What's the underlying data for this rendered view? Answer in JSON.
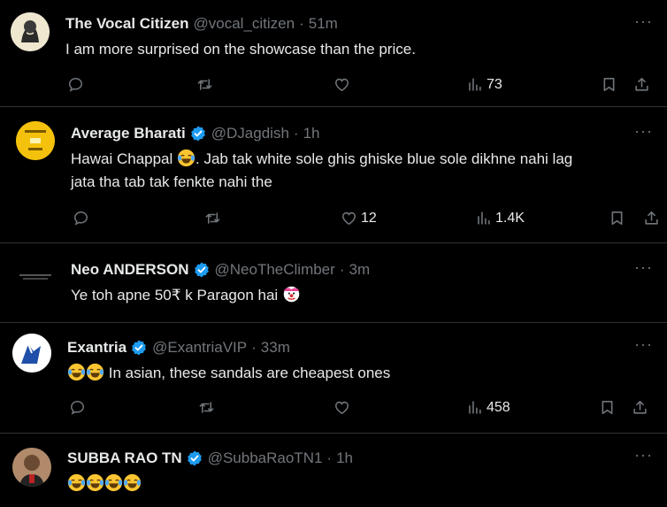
{
  "tweets": [
    {
      "name": "The Vocal Citizen",
      "handle": "@vocal_citizen",
      "time": "51m",
      "text": "I am more surprised on the showcase than the price.",
      "likes": "",
      "views": "73",
      "verified": false
    },
    {
      "name": "Average Bharati",
      "handle": "@DJagdish",
      "time": "1h",
      "text_a": "Hawai Chappal",
      "text_b": ". Jab tak white sole ghis ghiske blue sole dikhne nahi lag",
      "text_c": "jata tha tab tak fenkte nahi the",
      "likes": "12",
      "views": "1.4K",
      "verified": true
    },
    {
      "name": "Neo ANDERSON",
      "handle": "@NeoTheClimber",
      "time": "3m",
      "text": "Ye toh apne 50₹ k Paragon hai",
      "verified": true
    },
    {
      "name": "Exantria",
      "handle": "@ExantriaVIP",
      "time": "33m",
      "text": "In asian, these sandals are cheapest ones",
      "likes": "",
      "views": "458",
      "verified": true
    },
    {
      "name": "SUBBA RAO TN",
      "handle": "@SubbaRaoTN1",
      "time": "1h",
      "verified": true
    }
  ],
  "separator": "·",
  "more_label": "···",
  "colors": {
    "background": "#000000",
    "verified": "#1d9bf0",
    "muted": "#71767b"
  },
  "icons": [
    "reply-icon",
    "retweet-icon",
    "like-icon",
    "views-icon",
    "bookmark-icon",
    "share-icon",
    "verified-icon",
    "more-icon",
    "tears-of-joy-emoji",
    "clown-emoji"
  ]
}
